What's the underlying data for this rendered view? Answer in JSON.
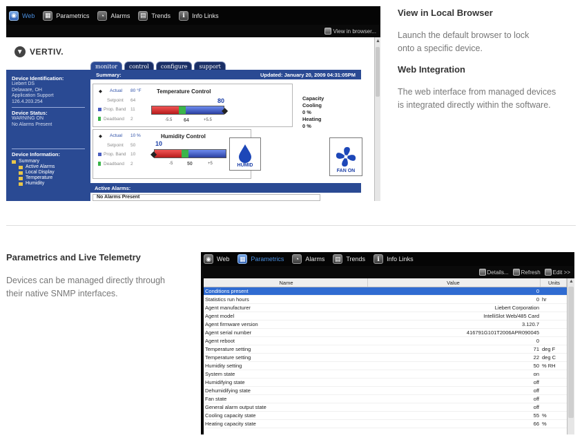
{
  "top_window": {
    "nav": [
      {
        "label": "Web",
        "active": true,
        "icon": "web-icon"
      },
      {
        "label": "Parametrics",
        "active": false,
        "icon": "parametrics-icon"
      },
      {
        "label": "Alarms",
        "active": false,
        "icon": "alarms-icon"
      },
      {
        "label": "Trends",
        "active": false,
        "icon": "trends-icon"
      },
      {
        "label": "Info Links",
        "active": false,
        "icon": "info-links-icon"
      }
    ],
    "toolbar": {
      "view_in_browser": "View in browser..."
    },
    "logo": "VERTIV.",
    "tabs": [
      "monitor",
      "control",
      "configure",
      "support"
    ],
    "sidebar": {
      "device_id_title": "Device Identification:",
      "device_id_lines": [
        "Liebert DS",
        "Delaware, OH",
        "Application Support",
        "126.4.203.254"
      ],
      "device_status_title": "Device Status:",
      "device_status_lines": [
        "WARNING ON",
        "No Alarms Present"
      ],
      "device_info_title": "Device Information:",
      "tree": [
        "Summary",
        "Active Alarms",
        "Local Display",
        "Temperature",
        "Humidity"
      ]
    },
    "summary": {
      "label": "Summary:",
      "updated": "Updated: January 20, 2009 04:31:05PM"
    },
    "temperature": {
      "title": "Temperature Control",
      "actual_label": "Actual",
      "actual_value": "80 °F",
      "setpoint_label": "Setpoint",
      "setpoint_value": "64",
      "propband_label": "Prop. Band",
      "propband_value": "11",
      "deadband_label": "Deadband",
      "deadband_value": "2",
      "big_value": "80",
      "scale": [
        "-5.5",
        "64",
        "+5.5"
      ]
    },
    "capacity": {
      "title": "Capacity",
      "cooling": "Cooling  0 %",
      "heating": "Heating  0 %"
    },
    "humidity": {
      "title": "Humidity Control",
      "actual_label": "Actual",
      "actual_value": "10 %",
      "setpoint_label": "Setpoint",
      "setpoint_value": "50",
      "propband_label": "Prop. Band",
      "propband_value": "10",
      "deadband_label": "Deadband",
      "deadband_value": "2",
      "big_value": "10",
      "scale": [
        "-5",
        "50",
        "+5"
      ]
    },
    "humid_button": "HUMID",
    "fan_button": "FAN ON",
    "active_alarms_title": "Active Alarms:",
    "no_alarms": "No Alarms Present"
  },
  "sections": {
    "view_local_title": "View in Local Browser",
    "view_local_text_1": "Launch the default browser to lock",
    "view_local_text_2": "onto a specific device.",
    "web_integration_title": "Web Integration",
    "web_integration_text_1": "The web interface from managed devices",
    "web_integration_text_2": "is integrated directly within the software.",
    "parametrics_title": "Parametrics and Live Telemetry",
    "parametrics_text_1": "Devices can be managed directly through",
    "parametrics_text_2": "their native SNMP interfaces."
  },
  "bottom_window": {
    "nav": [
      {
        "label": "Web",
        "active": false,
        "icon": "web-icon"
      },
      {
        "label": "Parametrics",
        "active": true,
        "icon": "parametrics-icon"
      },
      {
        "label": "Alarms",
        "active": false,
        "icon": "alarms-icon"
      },
      {
        "label": "Trends",
        "active": false,
        "icon": "trends-icon"
      },
      {
        "label": "Info Links",
        "active": false,
        "icon": "info-links-icon"
      }
    ],
    "toolbar": {
      "details": "Details...",
      "refresh": "Refresh",
      "edit": "Edit >>"
    },
    "columns": {
      "name": "Name",
      "value": "Value",
      "units": "Units"
    },
    "rows": [
      {
        "name": "Conditions present",
        "value": "0",
        "units": "",
        "selected": true
      },
      {
        "name": "Statistics run hours",
        "value": "0",
        "units": "hr"
      },
      {
        "name": "Agent manufacturer",
        "value": "Liebert Corporation",
        "units": ""
      },
      {
        "name": "Agent model",
        "value": "IntelliSlot Web/485 Card",
        "units": ""
      },
      {
        "name": "Agent firmware version",
        "value": "3.120.7",
        "units": ""
      },
      {
        "name": "Agent serial number",
        "value": "416791G101T2006APR090045",
        "units": ""
      },
      {
        "name": "Agent reboot",
        "value": "0",
        "units": ""
      },
      {
        "name": "Temperature setting",
        "value": "71",
        "units": "deg F"
      },
      {
        "name": "Temperature setting",
        "value": "22",
        "units": "deg C"
      },
      {
        "name": "Humidity setting",
        "value": "50",
        "units": "% RH"
      },
      {
        "name": "System state",
        "value": "on",
        "units": ""
      },
      {
        "name": "Humidifying state",
        "value": "off",
        "units": ""
      },
      {
        "name": "Dehumidifying state",
        "value": "off",
        "units": ""
      },
      {
        "name": "Fan state",
        "value": "off",
        "units": ""
      },
      {
        "name": "General alarm output state",
        "value": "off",
        "units": ""
      },
      {
        "name": "Cooling capacity state",
        "value": "55",
        "units": "%"
      },
      {
        "name": "Heating capacity state",
        "value": "66",
        "units": "%"
      }
    ]
  }
}
